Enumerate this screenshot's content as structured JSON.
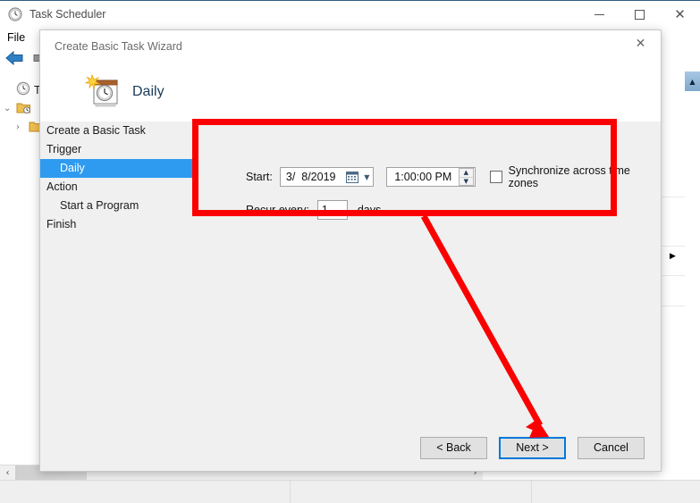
{
  "app": {
    "title": "Task Scheduler",
    "icon": "clock-icon",
    "window_controls": {
      "minimize": "minimize",
      "maximize": "maximize",
      "close": "close"
    },
    "menu": [
      {
        "label": "File"
      }
    ],
    "toolbar": {
      "back": "back-arrow",
      "forward": "forward-arrow"
    },
    "tree": [
      {
        "label": "Tas",
        "icon": "clock-icon",
        "chevron": "",
        "indent": 0
      },
      {
        "label": "",
        "icon": "folder-clock-icon",
        "chevron": "⌄",
        "indent": 0
      },
      {
        "label": "",
        "icon": "folder-icon",
        "chevron": "›",
        "indent": 1
      }
    ],
    "hscroll": {
      "left_arrow": "‹",
      "right_arrow": "›"
    },
    "vscroll": {
      "up_arrow": "▲"
    },
    "right_pane_expander": "▶"
  },
  "wizard": {
    "title": "Create Basic Task Wizard",
    "close_label": "✕",
    "header": {
      "icon": "calendar-clock-new-icon",
      "title": "Daily"
    },
    "nav": [
      {
        "label": "Create a Basic Task",
        "selected": false,
        "sub": false
      },
      {
        "label": "Trigger",
        "selected": false,
        "sub": false
      },
      {
        "label": "Daily",
        "selected": true,
        "sub": true
      },
      {
        "label": "Action",
        "selected": false,
        "sub": false
      },
      {
        "label": "Start a Program",
        "selected": false,
        "sub": true
      },
      {
        "label": "Finish",
        "selected": false,
        "sub": false
      }
    ],
    "form": {
      "start_label": "Start:",
      "start_date": "3/  8/2019",
      "start_date_calendar_icon": "calendar-icon",
      "start_date_chevron": "▼",
      "start_time": "1:00:00 PM",
      "spinner_up": "▲",
      "spinner_down": "▼",
      "sync_checkbox_checked": false,
      "sync_label": "Synchronize across time zones",
      "recur_label": "Recur every:",
      "recur_value": "1",
      "recur_unit": "days"
    },
    "buttons": {
      "back": "< Back",
      "next": "Next >",
      "cancel": "Cancel",
      "default_button": "Next >"
    }
  },
  "annotations": {
    "highlight_color": "#fb0000",
    "rectangle_target": "daily-trigger-settings",
    "arrow_target": "next-button"
  }
}
